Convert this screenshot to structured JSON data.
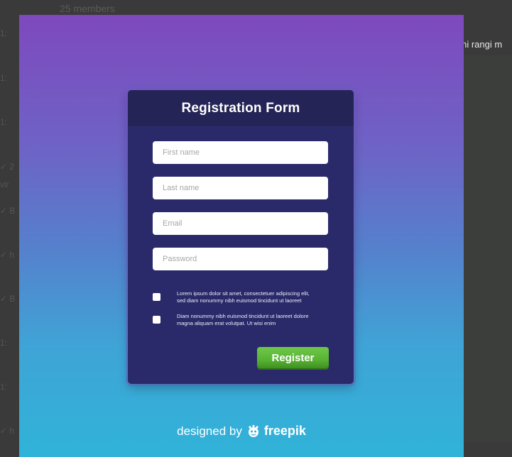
{
  "background": {
    "members_text": "25 members",
    "right_snippet": "ktni rangi m",
    "left_fragments": [
      "1:",
      "1:",
      "1:",
      "✓ 2",
      "vir",
      "✓ B",
      "✓ h",
      "✓ B",
      "1:",
      "1:",
      "✓ h"
    ]
  },
  "form": {
    "title": "Registration Form",
    "fields": [
      {
        "placeholder": "First name"
      },
      {
        "placeholder": "Last name"
      },
      {
        "placeholder": "Email"
      },
      {
        "placeholder": "Password"
      }
    ],
    "checks": [
      {
        "text": "Lorem ipsum dolor sit amet, consectetuer adipiscing elit, sed diam nonummy nibh euismod tincidunt ut laoreet",
        "checked": false
      },
      {
        "text": "Diam nonummy nibh euismod tincidunt ut laoreet dolore magna aliquam erat volutpat. Ut wisi enim",
        "checked": false
      }
    ],
    "register_label": "Register"
  },
  "credit": {
    "prefix": "designed by",
    "brand": "freepik",
    "logo_icon": "freepik-logo-icon"
  },
  "colors": {
    "gradient_top": "#7e49bd",
    "gradient_bottom": "#30b3d9",
    "card_bg": "#2a2a6a",
    "button_green": "#58b333"
  }
}
